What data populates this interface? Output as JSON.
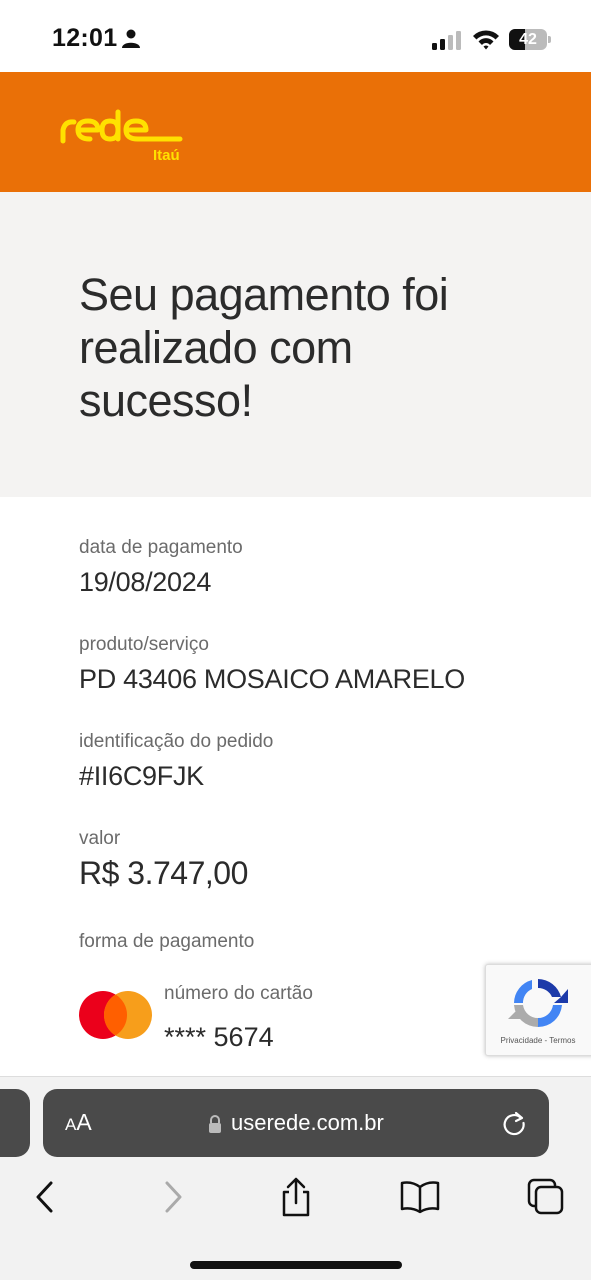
{
  "status_bar": {
    "time": "12:01",
    "battery_level": "42",
    "battery_fraction": 0.42,
    "icons": [
      "person-icon",
      "signal-icon",
      "wifi-icon",
      "battery-icon"
    ]
  },
  "brand": {
    "logo_word": "rede",
    "logo_sub": "Itaú",
    "accent_color": "#ea7007",
    "logo_color": "#ffe100"
  },
  "hero": {
    "title": "Seu pagamento foi realizado com sucesso!"
  },
  "details": {
    "payment_date": {
      "label": "data de pagamento",
      "value": "19/08/2024"
    },
    "product": {
      "label": "produto/serviço",
      "value": "PD 43406 MOSAICO AMARELO"
    },
    "order_id": {
      "label": "identificação do pedido",
      "value": "#II6C9FJK"
    },
    "amount": {
      "label": "valor",
      "value": "R$ 3.747,00"
    },
    "payment_method": {
      "label": "forma de pagamento",
      "card_brand_icon": "mastercard-icon",
      "card_number_label": "número do cartão",
      "card_number": "**** 5674"
    }
  },
  "recaptcha": {
    "privacy": "Privacidade",
    "separator": "-",
    "terms": "Termos"
  },
  "browser": {
    "text_size_big": "A",
    "text_size_small": "A",
    "url": "userede.com.br",
    "icons": [
      "lock-icon",
      "reload-icon",
      "back-icon",
      "forward-icon",
      "share-icon",
      "bookmarks-icon",
      "tabs-icon"
    ]
  }
}
